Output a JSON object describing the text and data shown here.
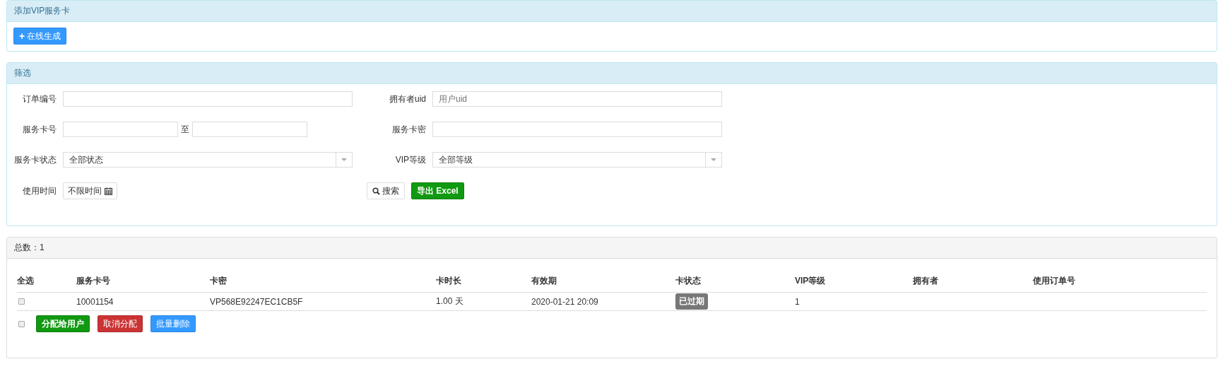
{
  "add_panel": {
    "title": "添加VIP服务卡",
    "button": {
      "icon": "+",
      "label": "在线生成"
    }
  },
  "filter_panel": {
    "title": "筛选",
    "order_no": {
      "label": "订单编号"
    },
    "owner_uid": {
      "label": "拥有者uid",
      "placeholder": "用户uid"
    },
    "card_no": {
      "label": "服务卡号",
      "separator": "至"
    },
    "card_secret": {
      "label": "服务卡密"
    },
    "card_status": {
      "label": "服务卡状态",
      "value": "全部状态"
    },
    "vip_level": {
      "label": "VIP等级",
      "value": "全部等级"
    },
    "use_time": {
      "label": "使用时间",
      "value": "不限时间"
    },
    "search_button": "搜索",
    "export_button": "导出 Excel"
  },
  "list_panel": {
    "title": "总数：1",
    "table": {
      "columns": [
        "全选",
        "服务卡号",
        "卡密",
        "卡时长",
        "有效期",
        "卡状态",
        "VIP等级",
        "拥有者",
        "使用订单号"
      ],
      "rows": [
        {
          "checked": false,
          "card_no": "10001154",
          "secret": "VP568E92247EC1CB5F",
          "duration": "1.00 天",
          "expires": "2020-01-21 20:09",
          "status": "已过期",
          "vip_level": "1",
          "owner": "",
          "order_no": ""
        }
      ]
    },
    "select_all_checked": false,
    "actions": [
      {
        "kind": "assign",
        "label": "分配给用户"
      },
      {
        "kind": "cancel",
        "label": "取消分配"
      },
      {
        "kind": "delete",
        "label": "批量删除"
      }
    ]
  }
}
